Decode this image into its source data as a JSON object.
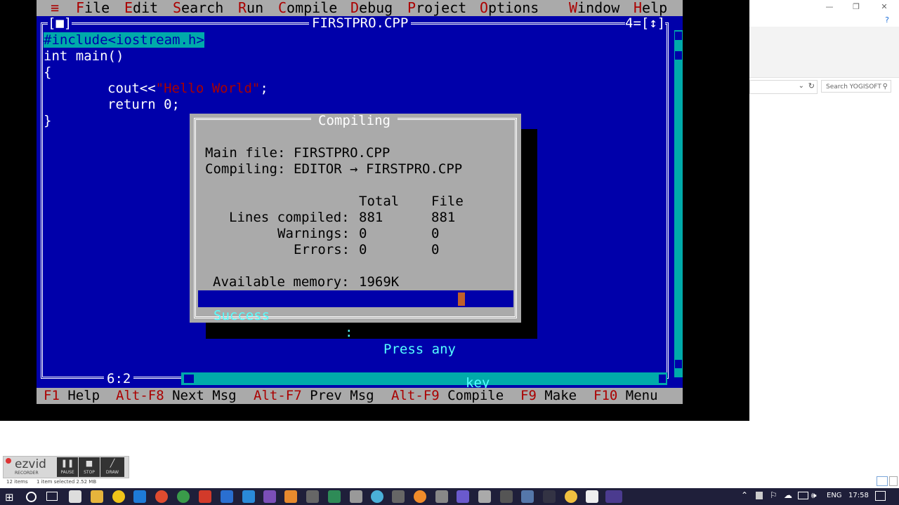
{
  "menu": {
    "system": "≡",
    "items": [
      {
        "hot": "F",
        "rest": "ile"
      },
      {
        "hot": "E",
        "rest": "dit"
      },
      {
        "hot": "S",
        "rest": "earch"
      },
      {
        "hot": "R",
        "rest": "un"
      },
      {
        "hot": "C",
        "rest": "ompile"
      },
      {
        "hot": "D",
        "rest": "ebug"
      },
      {
        "hot": "P",
        "rest": "roject"
      },
      {
        "hot": "O",
        "rest": "ptions"
      },
      {
        "hot": "W",
        "rest": "indow"
      },
      {
        "hot": "H",
        "rest": "elp"
      }
    ]
  },
  "editor": {
    "close_box": "[■]",
    "title": "FIRSTPRO.CPP",
    "window_number": "4",
    "zoom_box": "[↕]",
    "cursor_pos": "6:2",
    "code": {
      "line1": "#include<iostream.h>",
      "line2": "int main()",
      "line3": "{",
      "line4_pre": "cout<<",
      "line4_str": "\"Hello World\"",
      "line4_post": ";",
      "line5": "return 0;",
      "line6": "}"
    }
  },
  "dialog": {
    "title": "Compiling",
    "main_file_label": "Main file:",
    "main_file": "FIRSTPRO.CPP",
    "compiling_label": "Compiling:",
    "compiling_value": "EDITOR → FIRSTPRO.CPP",
    "col_total": "Total",
    "col_file": "File",
    "rows": [
      {
        "label": "Lines compiled:",
        "total": "881",
        "file": "881"
      },
      {
        "label": "Warnings:",
        "total": "0",
        "file": "0"
      },
      {
        "label": "Errors:",
        "total": "0",
        "file": "0"
      }
    ],
    "memory_label": "Available memory:",
    "memory_value": "1969K",
    "status": "Success",
    "sep": ":",
    "press_pre": "Press any",
    "press_post": "key"
  },
  "statusbar": [
    {
      "key": "F1",
      "label": "Help"
    },
    {
      "key": "Alt-F8",
      "label": "Next Msg"
    },
    {
      "key": "Alt-F7",
      "label": "Prev Msg"
    },
    {
      "key": "Alt-F9",
      "label": "Compile"
    },
    {
      "key": "F9",
      "label": "Make"
    },
    {
      "key": "F10",
      "label": "Menu"
    }
  ],
  "explorer": {
    "search_placeholder": "Search YOGISOFT",
    "minimize": "—",
    "maximize": "❐",
    "close": "✕",
    "help": "?",
    "items_count": "12 items",
    "selected": "1 item selected  2.52 MB"
  },
  "ezvid": {
    "brand": "ezvid",
    "sub": "RECORDER",
    "pause": "PAUSE",
    "stop": "STOP",
    "draw": "DRAW"
  },
  "taskbar": {
    "lang": "ENG",
    "time": "17:58"
  },
  "colors": {
    "dos_blue": "#0000aa",
    "dos_gray": "#aaaaaa",
    "dos_red": "#aa0000",
    "dos_cyan": "#00aaaa",
    "bright_cyan": "#55ffff"
  }
}
